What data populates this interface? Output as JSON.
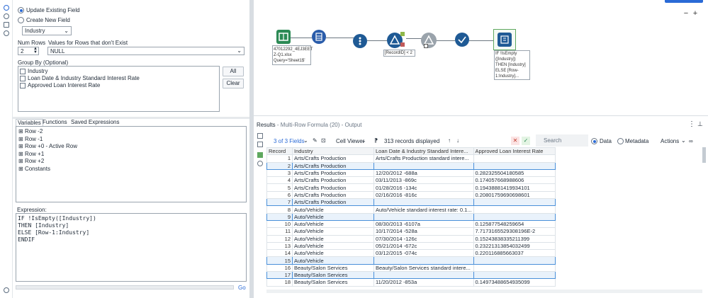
{
  "config": {
    "update_existing": "Update Existing Field",
    "create_new": "Create New  Field",
    "field_select": "Industry",
    "num_rows_label": "Num Rows",
    "num_rows_value": "2",
    "values_label": "Values for Rows that don't Exist",
    "values_select": "NULL",
    "group_by_label": "Group By (Optional)",
    "group_fields": [
      "Industry",
      "Loan Date & Industry Standard Interest Rate",
      "Approved Loan Interest Rate"
    ],
    "all_button": "All",
    "clear_button": "Clear"
  },
  "tabs": [
    "Variables",
    "Functions",
    "Saved Expressions"
  ],
  "variables": [
    "Row -2",
    "Row -1",
    "Row +0 - Active Row",
    "Row +1",
    "Row +2",
    "Constants"
  ],
  "expression": {
    "label": "Expression:",
    "lines": [
      "IF !IsEmpty([Industry])",
      "THEN [Industry]",
      "ELSE [Row-1:Industry]",
      "ENDIF"
    ],
    "go": "Go"
  },
  "canvas": {
    "input_annotation": [
      "47012292_4EJ3EET",
      "Z-Q1.xlsx",
      "Query='Sheet1$'"
    ],
    "filter_annotation": "[RecordID] < 2",
    "formula_annotation": [
      "IF !IsEmpty",
      "([Industry])",
      "THEN [Industry]",
      "ELSE [Row-",
      "1:Industry]..."
    ],
    "zoom_minus": "−",
    "zoom_plus": "+"
  },
  "results": {
    "title": "Results",
    "subtitle": "- Multi-Row Formula (20) - Output",
    "fields": "3 of 3 Fields",
    "cell_viewer": "Cell Viewer",
    "records": "313 records displayed",
    "search_placeholder": "Search",
    "data_label": "Data",
    "metadata_label": "Metadata",
    "actions_label": "Actions",
    "columns": [
      "Record",
      "Industry",
      "Loan Date & Industry Standard Intere...",
      "Approved Loan Interest Rate"
    ],
    "rows": [
      {
        "n": "1",
        "industry": "Arts/Crafts Production",
        "loan": "Arts/Crafts Production standard intere...",
        "rate": "",
        "sel": false
      },
      {
        "n": "2",
        "industry": "Arts/Crafts Production",
        "loan": "",
        "rate": "",
        "sel": true
      },
      {
        "n": "3",
        "industry": "Arts/Crafts Production",
        "loan": "12/20/2012 -688a",
        "rate": "0.282325504180585",
        "sel": false
      },
      {
        "n": "4",
        "industry": "Arts/Crafts Production",
        "loan": "03/11/2013 -869c",
        "rate": "0.174057668988606",
        "sel": false
      },
      {
        "n": "5",
        "industry": "Arts/Crafts Production",
        "loan": "01/28/2016 -134c",
        "rate": "0.19438881419934101",
        "sel": false
      },
      {
        "n": "6",
        "industry": "Arts/Crafts Production",
        "loan": "02/16/2016 -816c",
        "rate": "0.20801759690698601",
        "sel": false
      },
      {
        "n": "7",
        "industry": "Arts/Crafts Production",
        "loan": "",
        "rate": "",
        "sel": true
      },
      {
        "n": "8",
        "industry": "Auto/Vehicle",
        "loan": "Auto/Vehicle standard interest rate: 0.1...",
        "rate": "",
        "sel": false
      },
      {
        "n": "9",
        "industry": "Auto/Vehicle",
        "loan": "",
        "rate": "",
        "sel": true
      },
      {
        "n": "10",
        "industry": "Auto/Vehicle",
        "loan": "08/30/2013 -6107a",
        "rate": "0.125877548259654",
        "sel": false
      },
      {
        "n": "11",
        "industry": "Auto/Vehicle",
        "loan": "10/17/2014 -528a",
        "rate": "7.7173165529308196E-2",
        "sel": false
      },
      {
        "n": "12",
        "industry": "Auto/Vehicle",
        "loan": "07/30/2014 -126c",
        "rate": "0.15243838335211399",
        "sel": false
      },
      {
        "n": "13",
        "industry": "Auto/Vehicle",
        "loan": "05/21/2014 -672c",
        "rate": "0.23221313854032499",
        "sel": false
      },
      {
        "n": "14",
        "industry": "Auto/Vehicle",
        "loan": "03/12/2015 -074c",
        "rate": "0.220116885663037",
        "sel": false
      },
      {
        "n": "15",
        "industry": "Auto/Vehicle",
        "loan": "",
        "rate": "",
        "sel": true
      },
      {
        "n": "16",
        "industry": "Beauty/Salon Services",
        "loan": "Beauty/Salon Services standard intere...",
        "rate": "",
        "sel": false
      },
      {
        "n": "17",
        "industry": "Beauty/Salon Services",
        "loan": "",
        "rate": "",
        "sel": true
      },
      {
        "n": "18",
        "industry": "Beauty/Salon Services",
        "loan": "11/20/2012 -853a",
        "rate": "0.14973488654935099",
        "sel": false
      }
    ]
  },
  "colors": {
    "accent": "#2a6ad6",
    "tool_input": "#2c8a55",
    "tool_select": "#2a5caa",
    "tool_filter": "#1f5a95",
    "tool_formula": "#1f5a95",
    "selection": "#4a90d9"
  }
}
